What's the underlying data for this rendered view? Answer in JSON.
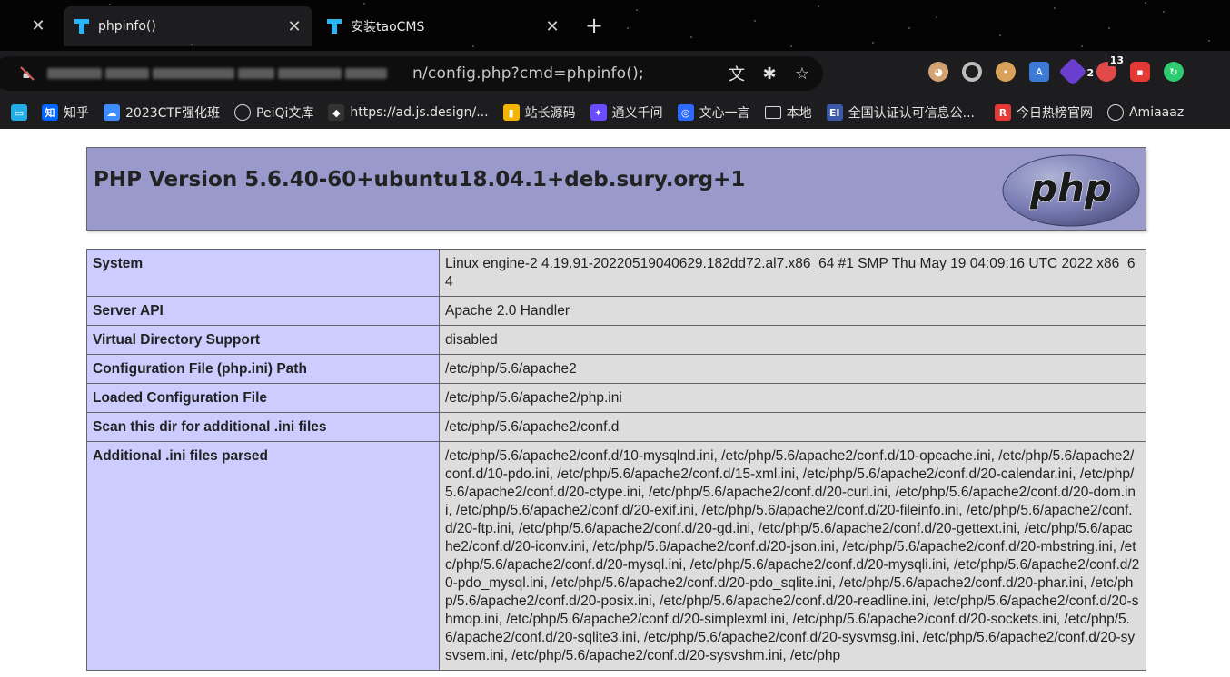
{
  "browser": {
    "tabs": [
      {
        "title": "phpinfo()",
        "active": true
      },
      {
        "title": "安装taoCMS",
        "active": false
      }
    ],
    "address_bar": {
      "url_visible_suffix": "n/config.php?cmd=phpinfo();"
    },
    "extensions": [
      {
        "name": "face-extension",
        "color": "#d4a373"
      },
      {
        "name": "circle-extension",
        "color": "#bdbdbd"
      },
      {
        "name": "cookie-extension",
        "color": "#d9a25a"
      },
      {
        "name": "translate-extension",
        "color": "#3b7bd6"
      },
      {
        "name": "purple-extension",
        "color": "#6a3fd0",
        "badge": "2"
      },
      {
        "name": "red-extension",
        "color": "#e24a4a",
        "badge": "13"
      },
      {
        "name": "game-extension",
        "color": "#e53935"
      },
      {
        "name": "green-extension",
        "color": "#2ecc71"
      }
    ],
    "bookmarks": [
      {
        "label": "",
        "icon": "bilibili-icon",
        "color": "#23ade5"
      },
      {
        "label": "知乎",
        "icon": "zhihu-icon",
        "color": "#0066ff",
        "glyph": "知"
      },
      {
        "label": "2023CTF强化班",
        "icon": "cloud-icon",
        "color": "#3f8cff"
      },
      {
        "label": "PeiQi文库",
        "icon": "globe-icon"
      },
      {
        "label": "https://ad.js.design/...",
        "icon": "jsdesign-icon",
        "color": "#333333"
      },
      {
        "label": "站长源码",
        "icon": "zzym-icon",
        "color": "#f5b400"
      },
      {
        "label": "通义千问",
        "icon": "tongyi-icon",
        "color": "#6b4cff"
      },
      {
        "label": "文心一言",
        "icon": "wenxin-icon",
        "color": "#2d6bff"
      },
      {
        "label": "本地",
        "icon": "folder-icon"
      },
      {
        "label": "全国认证认可信息公...",
        "icon": "cnca-icon",
        "color": "#3a5aa8",
        "glyph": "EI"
      },
      {
        "label": "今日热榜官网",
        "icon": "rebang-icon",
        "color": "#e53935",
        "glyph": "R"
      },
      {
        "label": "Amiaaaz",
        "icon": "globe-icon"
      }
    ]
  },
  "phpinfo": {
    "title": "PHP Version 5.6.40-60+ubuntu18.04.1+deb.sury.org+1",
    "logo_text": "php",
    "rows": [
      {
        "key": "System",
        "value": "Linux engine-2 4.19.91-20220519040629.182dd72.al7.x86_64 #1 SMP Thu May 19 04:09:16 UTC 2022 x86_64"
      },
      {
        "key": "Server API",
        "value": "Apache 2.0 Handler"
      },
      {
        "key": "Virtual Directory Support",
        "value": "disabled"
      },
      {
        "key": "Configuration File (php.ini) Path",
        "value": "/etc/php/5.6/apache2"
      },
      {
        "key": "Loaded Configuration File",
        "value": "/etc/php/5.6/apache2/php.ini"
      },
      {
        "key": "Scan this dir for additional .ini files",
        "value": "/etc/php/5.6/apache2/conf.d"
      },
      {
        "key": "Additional .ini files parsed",
        "value": "/etc/php/5.6/apache2/conf.d/10-mysqlnd.ini, /etc/php/5.6/apache2/conf.d/10-opcache.ini, /etc/php/5.6/apache2/conf.d/10-pdo.ini, /etc/php/5.6/apache2/conf.d/15-xml.ini, /etc/php/5.6/apache2/conf.d/20-calendar.ini, /etc/php/5.6/apache2/conf.d/20-ctype.ini, /etc/php/5.6/apache2/conf.d/20-curl.ini, /etc/php/5.6/apache2/conf.d/20-dom.ini, /etc/php/5.6/apache2/conf.d/20-exif.ini, /etc/php/5.6/apache2/conf.d/20-fileinfo.ini, /etc/php/5.6/apache2/conf.d/20-ftp.ini, /etc/php/5.6/apache2/conf.d/20-gd.ini, /etc/php/5.6/apache2/conf.d/20-gettext.ini, /etc/php/5.6/apache2/conf.d/20-iconv.ini, /etc/php/5.6/apache2/conf.d/20-json.ini, /etc/php/5.6/apache2/conf.d/20-mbstring.ini, /etc/php/5.6/apache2/conf.d/20-mysql.ini, /etc/php/5.6/apache2/conf.d/20-mysqli.ini, /etc/php/5.6/apache2/conf.d/20-pdo_mysql.ini, /etc/php/5.6/apache2/conf.d/20-pdo_sqlite.ini, /etc/php/5.6/apache2/conf.d/20-phar.ini, /etc/php/5.6/apache2/conf.d/20-posix.ini, /etc/php/5.6/apache2/conf.d/20-readline.ini, /etc/php/5.6/apache2/conf.d/20-shmop.ini, /etc/php/5.6/apache2/conf.d/20-simplexml.ini, /etc/php/5.6/apache2/conf.d/20-sockets.ini, /etc/php/5.6/apache2/conf.d/20-sqlite3.ini, /etc/php/5.6/apache2/conf.d/20-sysvmsg.ini, /etc/php/5.6/apache2/conf.d/20-sysvsem.ini, /etc/php/5.6/apache2/conf.d/20-sysvshm.ini, /etc/php"
      }
    ]
  }
}
